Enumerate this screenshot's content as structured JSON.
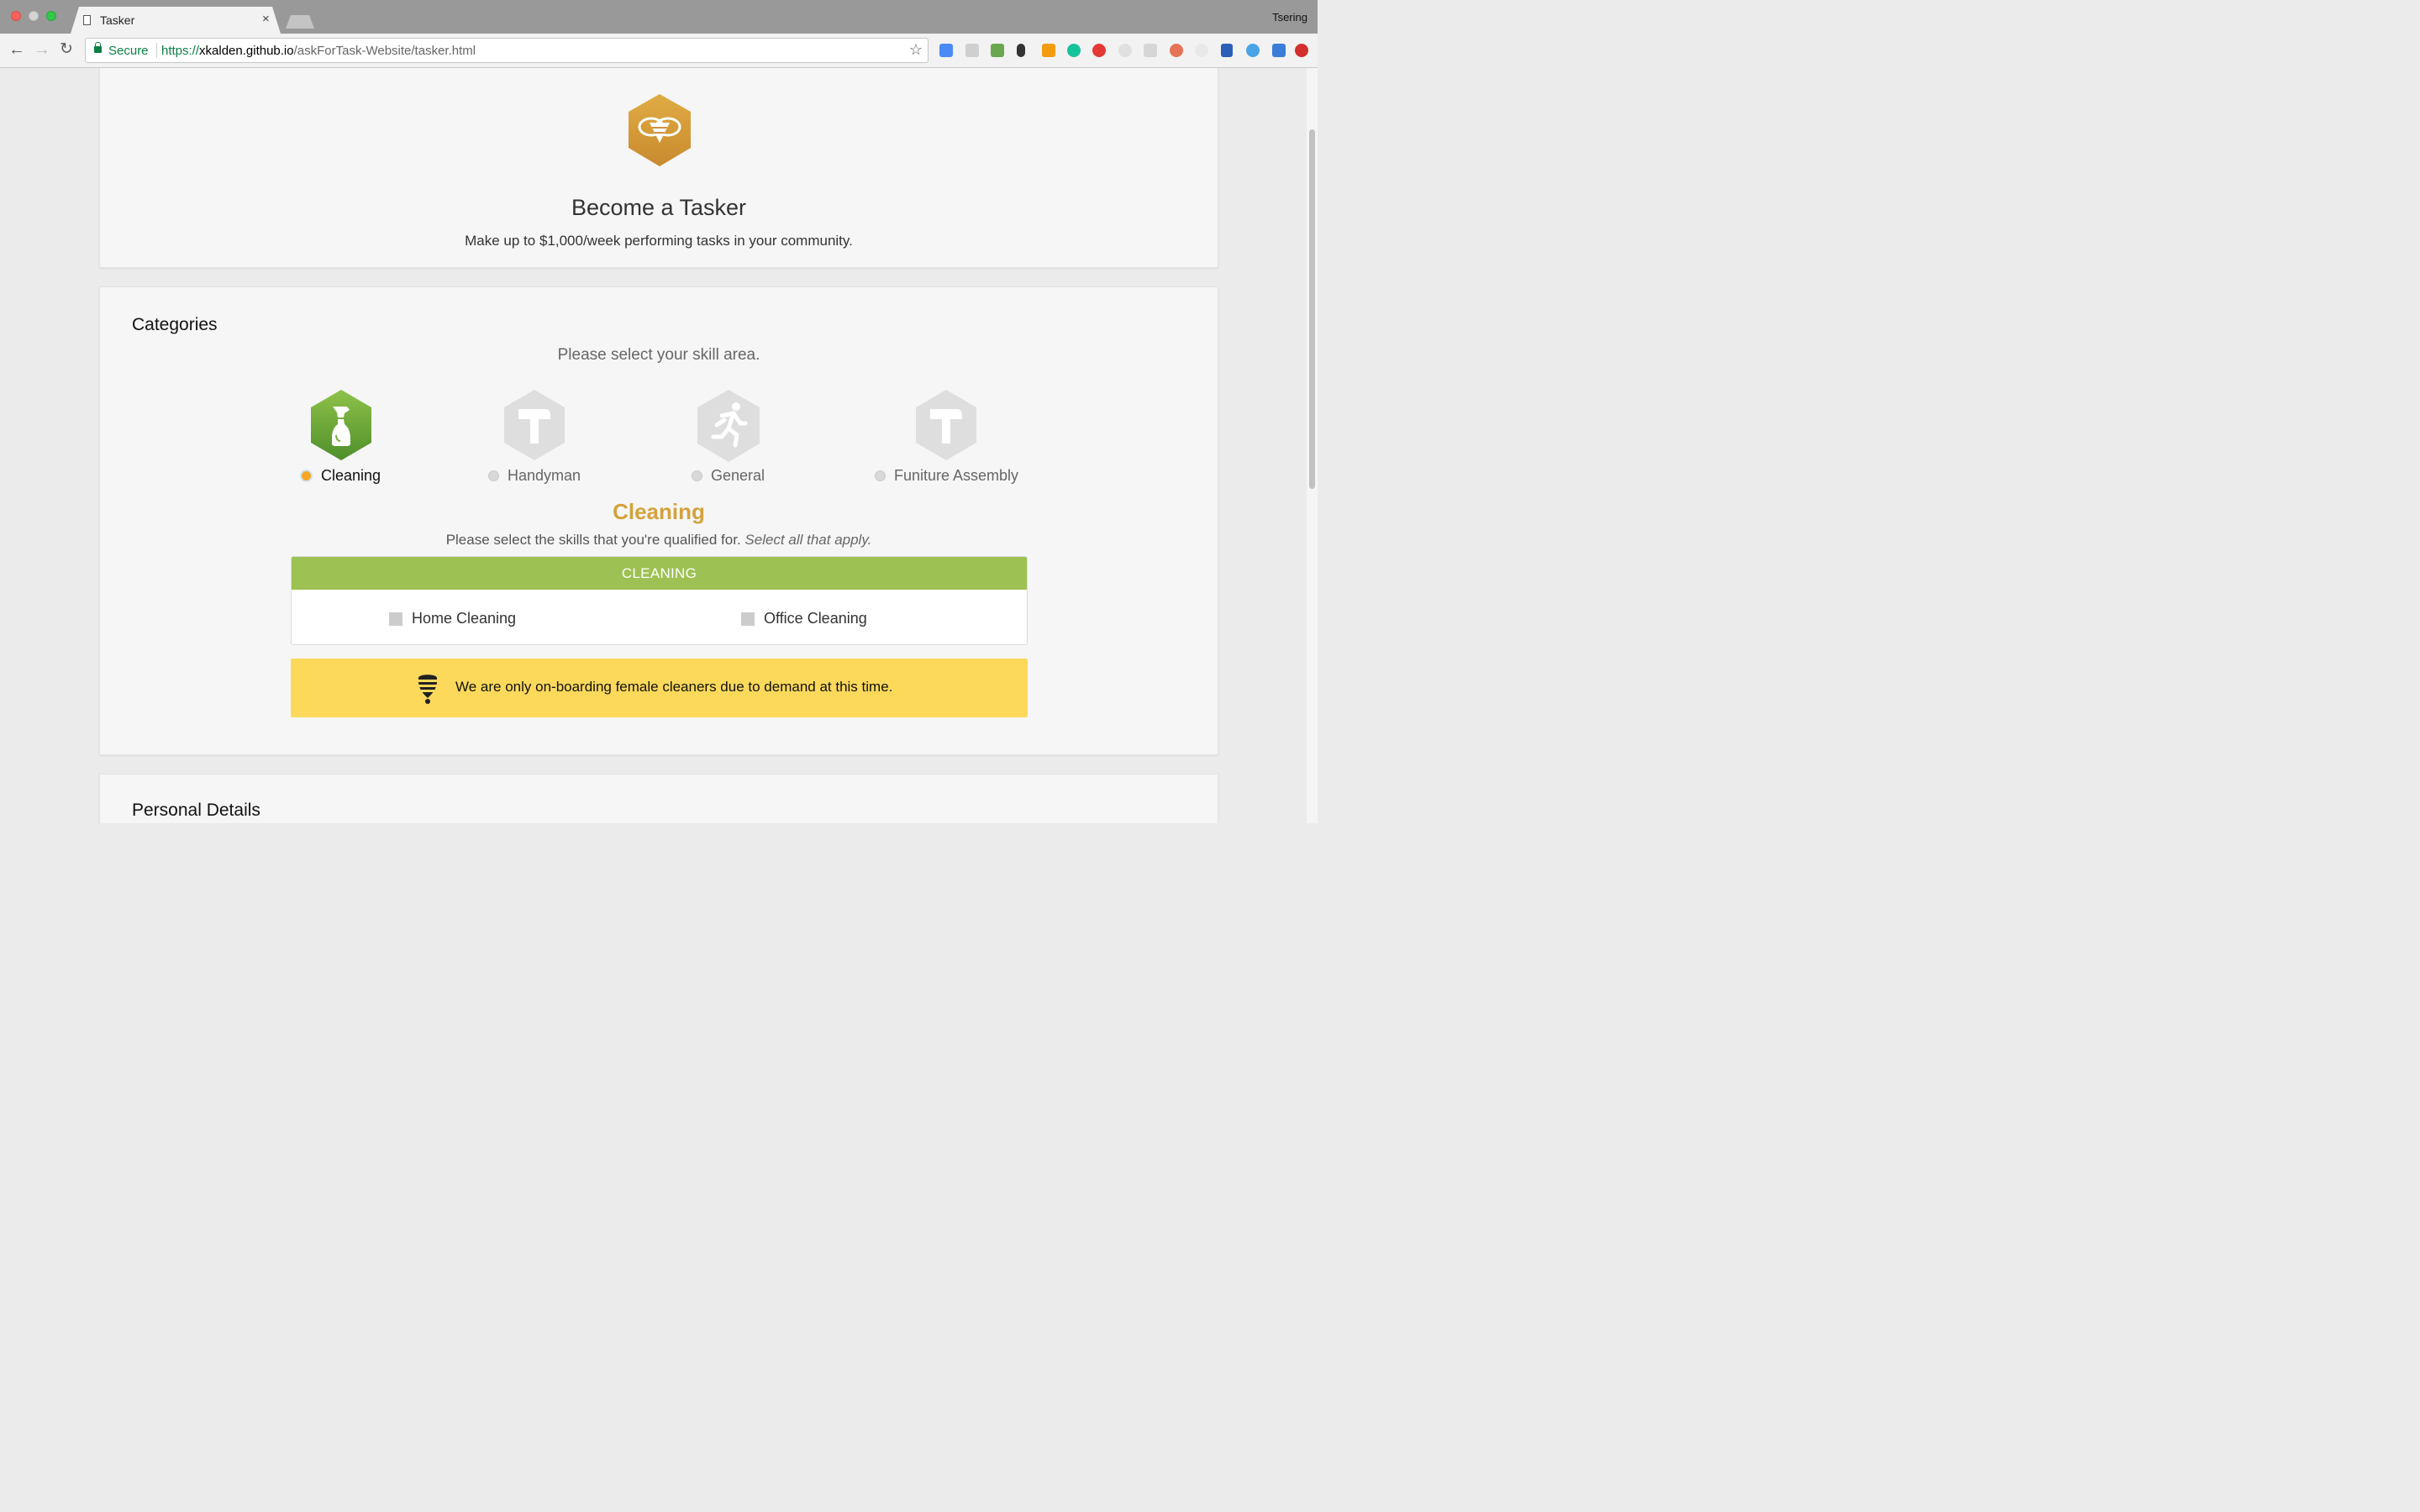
{
  "browser": {
    "tab_title": "Tasker",
    "tab_close": "×",
    "profile_name": "Tsering",
    "secure_label": "Secure",
    "url_scheme": "https://",
    "url_host": "xkalden.github.io",
    "url_path": "/askForTask-Website/tasker.html",
    "back_icon": "←",
    "forward_icon": "→",
    "reload_icon": "↻",
    "bookmark_icon": "☆"
  },
  "hero": {
    "title": "Become a Tasker",
    "subtitle": "Make up to $1,000/week performing tasks in your community."
  },
  "categories": {
    "section_title": "Categories",
    "prompt": "Please select your skill area.",
    "items": [
      {
        "label": "Cleaning",
        "icon": "spray-bottle-icon",
        "selected": true
      },
      {
        "label": "Handyman",
        "icon": "hammer-icon",
        "selected": false
      },
      {
        "label": "General",
        "icon": "running-person-icon",
        "selected": false
      },
      {
        "label": "Funiture Assembly",
        "icon": "hammer-icon",
        "selected": false
      }
    ]
  },
  "skills": {
    "title": "Cleaning",
    "prompt": "Please select the skills that you're qualified for. ",
    "prompt_em": "Select all that apply.",
    "header": "CLEANING",
    "options": [
      {
        "label": "Home Cleaning",
        "checked": false
      },
      {
        "label": "Office Cleaning",
        "checked": false
      }
    ]
  },
  "notice": {
    "text": "We are only on-boarding female cleaners due to demand at this time."
  },
  "personal": {
    "section_title": "Personal Details"
  },
  "colors": {
    "accent_gold": "#d4a23c",
    "cleaning_green": "#9dc152",
    "notice_yellow": "#fcd95b",
    "secure_green": "#0b8043"
  }
}
